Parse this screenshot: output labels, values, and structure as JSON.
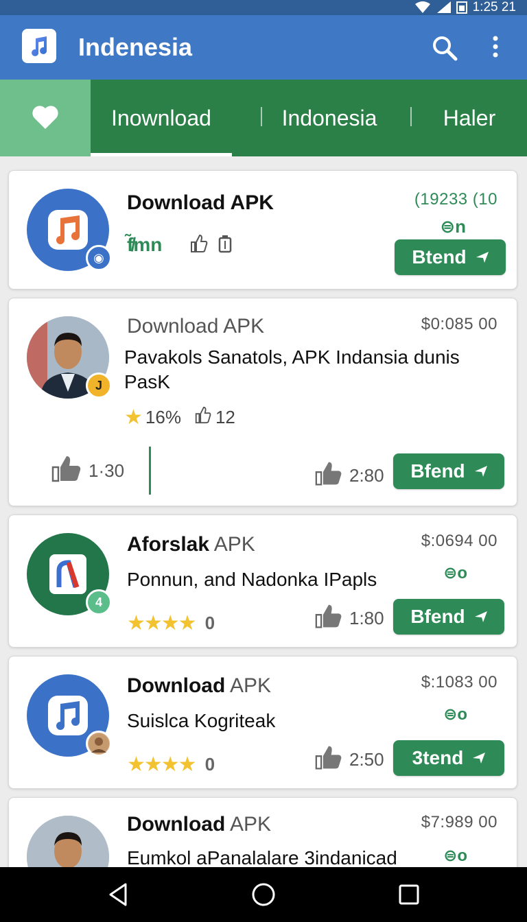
{
  "status_bar": {
    "time": "1:25 21"
  },
  "app_bar": {
    "title": "Indenesia",
    "logo_icon": "music-note-icon",
    "search_icon": "search-icon",
    "more_icon": "more-vert-icon"
  },
  "tabs": [
    {
      "label": "Inownload",
      "active": true
    },
    {
      "label": "Indonesia",
      "active": false
    },
    {
      "label": "Haler",
      "active": false
    }
  ],
  "cards": [
    {
      "title_bold": "Download APK",
      "title_light": "",
      "price": "(19233 (10",
      "price_color": "#2e8a57",
      "icon_row": "f̸̃mn",
      "badge_label": "◉",
      "button": "Btend",
      "price_icon": "⊜n"
    },
    {
      "title_bold": "",
      "title_light": "Download APK",
      "price": "$0:085 00",
      "desc": "Pavakols Sanatols, APK Indansia dunis PasK",
      "badge_label": "J",
      "rating": "16%",
      "rating_count": "12",
      "like_left": "1·30",
      "like_right": "2:80",
      "button": "Bfend"
    },
    {
      "title_bold": "Aforslak",
      "title_light": "APK",
      "price": "$:0694 00",
      "desc": "Ponnun, and Nadonka IPapls",
      "badge_label": "4",
      "stars": "★★★★",
      "star_count": "0",
      "like": "1:80",
      "button": "Bfend",
      "price_icon": "⊜o"
    },
    {
      "title_bold": "Download",
      "title_light": "APK",
      "price": "$:1083 00",
      "desc": "Suislca Kogriteak",
      "stars": "★★★★",
      "star_count": "0",
      "like": "2:50",
      "button": "3tend",
      "price_icon": "⊜o"
    },
    {
      "title_bold": "Download",
      "title_light": "APK",
      "price": "$7:989 00",
      "desc": "Eumkol aPanalalare 3indanicad",
      "price_icon": "⊜o"
    }
  ],
  "colors": {
    "app_bar": "#3f78c4",
    "tab_bar": "#2a8047",
    "accent": "#2e8a57",
    "star": "#f2c230"
  }
}
